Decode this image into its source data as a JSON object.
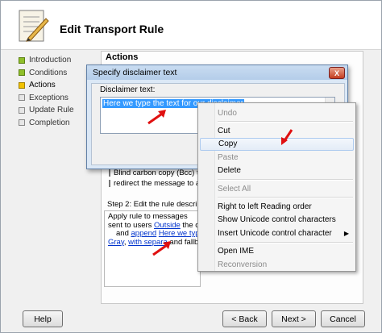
{
  "window": {
    "title": "Edit Transport Rule"
  },
  "steps": [
    {
      "label": "Introduction",
      "state": "done"
    },
    {
      "label": "Conditions",
      "state": "done"
    },
    {
      "label": "Actions",
      "state": "current"
    },
    {
      "label": "Exceptions",
      "state": "todo"
    },
    {
      "label": "Update Rule",
      "state": "todo"
    },
    {
      "label": "Completion",
      "state": "todo"
    }
  ],
  "main": {
    "section_label": "Actions",
    "checkbox_rows": [
      "Blind carbon copy (Bcc) the",
      "redirect the message to ado"
    ],
    "step2_label": "Step 2: Edit the rule description b",
    "description": {
      "line1": "Apply rule to messages",
      "line2_prefix": "sent to users ",
      "line2_link": "Outside",
      "line2_suffix": " the orga",
      "line3_prefix": "and ",
      "line3_link1": "append",
      "line3_link2": "Here we type the",
      "line4_link1": "Gray",
      "line4_mid": ", ",
      "line4_link2": "with separa",
      "line4_suffix": " and fallba"
    }
  },
  "dialog": {
    "title": "Specify disclaimer text",
    "close_glyph": "X",
    "field_label": "Disclaimer text:",
    "field_value": "Here we type the text for our disclaimer"
  },
  "context_menu": {
    "items": [
      {
        "label": "Undo",
        "disabled": true
      },
      {
        "sep": true
      },
      {
        "label": "Cut",
        "disabled": false
      },
      {
        "label": "Copy",
        "disabled": false,
        "highlighted": true
      },
      {
        "label": "Paste",
        "disabled": true
      },
      {
        "label": "Delete",
        "disabled": false
      },
      {
        "sep": true
      },
      {
        "label": "Select All",
        "disabled": true
      },
      {
        "sep": true
      },
      {
        "label": "Right to left Reading order",
        "disabled": false
      },
      {
        "label": "Show Unicode control characters",
        "disabled": false
      },
      {
        "label": "Insert Unicode control character",
        "disabled": false,
        "submenu": true
      },
      {
        "sep": true
      },
      {
        "label": "Open IME",
        "disabled": false
      },
      {
        "label": "Reconversion",
        "disabled": true
      }
    ],
    "submenu_glyph": "▶"
  },
  "buttons": {
    "help": "Help",
    "back": "< Back",
    "next": "Next >",
    "cancel": "Cancel"
  },
  "colors": {
    "arrow": "#e01010",
    "selection": "#3399ff",
    "link": "#0033cc",
    "step_done": "#8fbf2a",
    "step_current": "#f2c200"
  }
}
